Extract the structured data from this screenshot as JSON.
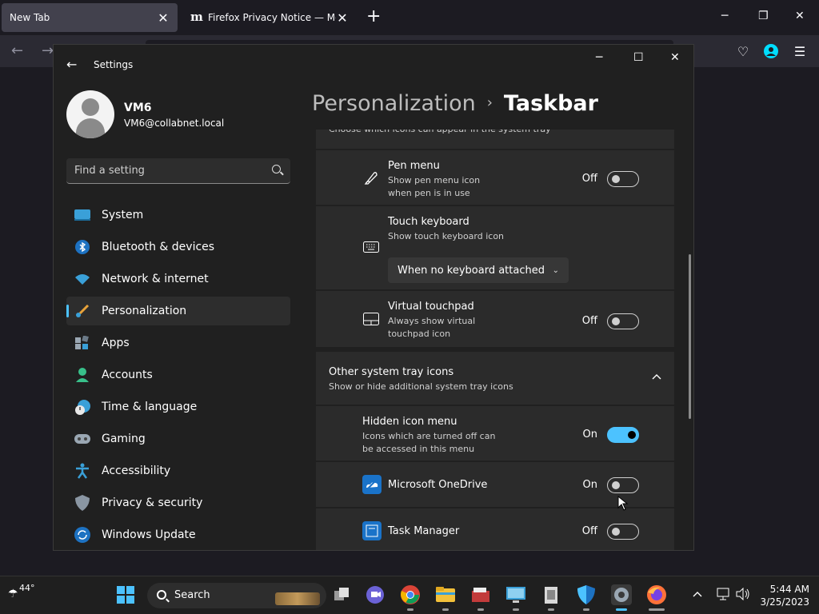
{
  "browser": {
    "tabs": [
      {
        "label": "New Tab"
      },
      {
        "label": "Firefox Privacy Notice — Mozilla",
        "favicon": "m"
      }
    ]
  },
  "settings": {
    "app_title": "Settings",
    "user": {
      "name": "VM6",
      "email": "VM6@collabnet.local"
    },
    "search": {
      "placeholder": "Find a setting"
    },
    "nav": [
      {
        "label": "System",
        "icon": "system-icon"
      },
      {
        "label": "Bluetooth & devices",
        "icon": "bluetooth-icon"
      },
      {
        "label": "Network & internet",
        "icon": "wifi-icon"
      },
      {
        "label": "Personalization",
        "icon": "brush-icon",
        "selected": true
      },
      {
        "label": "Apps",
        "icon": "apps-icon"
      },
      {
        "label": "Accounts",
        "icon": "accounts-icon"
      },
      {
        "label": "Time & language",
        "icon": "clock-icon"
      },
      {
        "label": "Gaming",
        "icon": "gamepad-icon"
      },
      {
        "label": "Accessibility",
        "icon": "accessibility-icon"
      },
      {
        "label": "Privacy & security",
        "icon": "shield-icon"
      },
      {
        "label": "Windows Update",
        "icon": "update-icon"
      }
    ],
    "breadcrumb": {
      "parent": "Personalization",
      "separator": "›",
      "current": "Taskbar"
    },
    "section_top_desc": "Choose which icons can appear in the system tray",
    "pen_menu": {
      "title": "Pen menu",
      "desc1": "Show pen menu icon",
      "desc2": "when pen is in use",
      "state": "Off"
    },
    "touch_keyboard": {
      "title": "Touch keyboard",
      "desc": "Show touch keyboard icon",
      "dropdown": "When no keyboard attached"
    },
    "virtual_touchpad": {
      "title": "Virtual touchpad",
      "desc1": "Always show virtual",
      "desc2": "touchpad icon",
      "state": "Off"
    },
    "other_tray": {
      "title": "Other system tray icons",
      "desc": "Show or hide additional system tray icons"
    },
    "hidden_icon_menu": {
      "title": "Hidden icon menu",
      "desc1": "Icons which are turned off can",
      "desc2": "be accessed in this menu",
      "state": "On"
    },
    "onedrive": {
      "title": "Microsoft OneDrive",
      "state": "On"
    },
    "task_manager": {
      "title": "Task Manager",
      "state": "Off"
    }
  },
  "taskbar": {
    "weather_temp": "44°",
    "search_label": "Search",
    "time": "5:44 AM",
    "date": "3/25/2023"
  }
}
